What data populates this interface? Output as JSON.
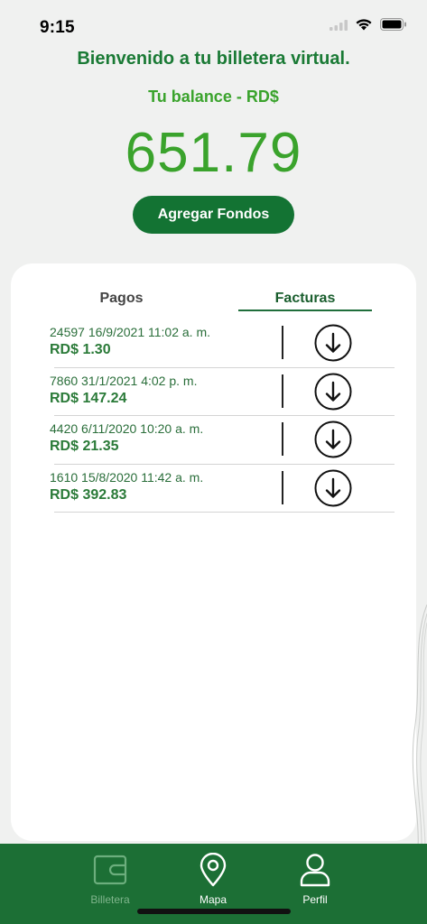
{
  "status": {
    "time": "9:15",
    "icons": [
      "signal-icon",
      "wifi-icon",
      "battery-icon"
    ]
  },
  "header": {
    "welcome": "Bienvenido a tu billetera virtual.",
    "balance_label": "Tu balance - RD$",
    "balance_value": "651.79",
    "add_funds_label": "Agregar Fondos"
  },
  "tabs": [
    {
      "label": "Pagos",
      "active": false
    },
    {
      "label": "Facturas",
      "active": true
    }
  ],
  "invoices": [
    {
      "line1": "24597 16/9/2021 11:02 a. m.",
      "amount": "RD$ 1.30"
    },
    {
      "line1": "7860 31/1/2021 4:02 p. m.",
      "amount": "RD$ 147.24"
    },
    {
      "line1": "4420 6/11/2020 10:20 a. m.",
      "amount": "RD$ 21.35"
    },
    {
      "line1": "1610 15/8/2020 11:42 a. m.",
      "amount": "RD$ 392.83"
    }
  ],
  "tabbar": {
    "items": [
      {
        "label": "Billetera",
        "icon": "wallet-icon",
        "active": false
      },
      {
        "label": "Mapa",
        "icon": "map-pin-icon",
        "active": true
      },
      {
        "label": "Perfil",
        "icon": "user-icon",
        "active": true
      }
    ]
  },
  "colors": {
    "brand_dark": "#137333",
    "brand_light": "#3aa32c",
    "tabbar_bg": "#1c6f35"
  }
}
